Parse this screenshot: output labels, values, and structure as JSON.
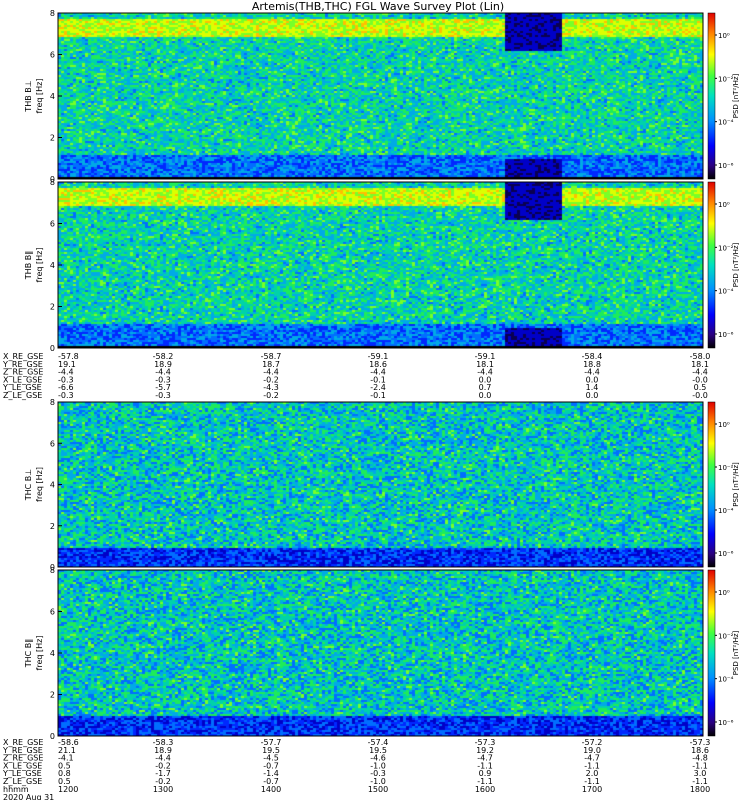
{
  "title": "Artemis(THB,THC) FGL Wave Survey Plot (Lin)",
  "colorbar": {
    "label": "PSD [nT²/Hz]",
    "ticks": [
      "10⁰",
      "10⁻²",
      "10⁻⁴",
      "10⁻⁶"
    ]
  },
  "chart_data": [
    {
      "type": "heatmap",
      "probe_label": "THB B⊥",
      "ylabel": "freq [Hz]",
      "ylim": [
        0,
        8
      ],
      "yticks": [
        0,
        2,
        4,
        6,
        8
      ],
      "colorscale": "log",
      "features": "strong power band 7-7.8 Hz, data gap near 1600",
      "colorbar_ticks": [
        "10⁰",
        "10⁻²",
        "10⁻⁴",
        "10⁻⁶"
      ]
    },
    {
      "type": "heatmap",
      "probe_label": "THB B‖",
      "ylabel": "freq [Hz]",
      "ylim": [
        0,
        8
      ],
      "yticks": [
        0,
        2,
        4,
        6,
        8
      ],
      "colorscale": "log",
      "features": "strong power band 7-7.8 Hz, data gap near 1600",
      "colorbar_ticks": [
        "10⁰",
        "10⁻²",
        "10⁻⁴",
        "10⁻⁶"
      ]
    },
    {
      "type": "heatmap",
      "probe_label": "THC B⊥",
      "ylabel": "freq [Hz]",
      "ylim": [
        0,
        8
      ],
      "yticks": [
        0,
        2,
        4,
        6,
        8
      ],
      "colorscale": "log",
      "colorbar_ticks": [
        "10⁰",
        "10⁻²",
        "10⁻⁴",
        "10⁻⁶"
      ]
    },
    {
      "type": "heatmap",
      "probe_label": "THC B‖",
      "ylabel": "freq [Hz]",
      "ylim": [
        0,
        8
      ],
      "yticks": [
        0,
        2,
        4,
        6,
        8
      ],
      "colorscale": "log",
      "colorbar_ticks": [
        "10⁰",
        "10⁻²",
        "10⁻⁴",
        "10⁻⁶"
      ]
    }
  ],
  "ephemeris_thb": {
    "rows": [
      {
        "label": "X_RE_GSE",
        "values": [
          "-57.8",
          "-58.2",
          "-58.7",
          "-59.1",
          "-59.1",
          "-58.4",
          "-58.0"
        ]
      },
      {
        "label": "Y_RE_GSE",
        "values": [
          "19.1",
          "18.9",
          "18.7",
          "18.6",
          "18.1",
          "18.8",
          "18.1"
        ]
      },
      {
        "label": "Z_RE_GSE",
        "values": [
          "-4.4",
          "-4.4",
          "-4.4",
          "-4.4",
          "-4.4",
          "-4.4",
          "-4.4"
        ]
      },
      {
        "label": "X_LE_GSE",
        "values": [
          "-0.3",
          "-0.3",
          "-0.2",
          "-0.1",
          "0.0",
          "0.0",
          "-0.0"
        ]
      },
      {
        "label": "Y_LE_GSE",
        "values": [
          "-6.6",
          "-5.7",
          "-4.3",
          "-2.4",
          "0.7",
          "1.4",
          "0.5"
        ]
      },
      {
        "label": "Z_LE_GSE",
        "values": [
          "-0.3",
          "-0.3",
          "-0.2",
          "-0.1",
          "0.0",
          "0.0",
          "-0.0"
        ]
      }
    ]
  },
  "ephemeris_thc": {
    "rows": [
      {
        "label": "X_RE_GSE",
        "values": [
          "-58.6",
          "-58.3",
          "-57.7",
          "-57.4",
          "-57.3",
          "-57.2",
          "-57.3"
        ]
      },
      {
        "label": "Y_RE_GSE",
        "values": [
          "21.1",
          "18.9",
          "19.5",
          "19.5",
          "19.2",
          "19.0",
          "18.6"
        ]
      },
      {
        "label": "Z_RE_GSE",
        "values": [
          "-4.1",
          "-4.4",
          "-4.5",
          "-4.6",
          "-4.7",
          "-4.7",
          "-4.8"
        ]
      },
      {
        "label": "X_LE_GSE",
        "values": [
          "0.5",
          "-0.2",
          "-0.7",
          "-1.0",
          "-1.1",
          "-1.1",
          "-1.1"
        ]
      },
      {
        "label": "Y_LE_GSE",
        "values": [
          "0.8",
          "-1.7",
          "-1.4",
          "-0.3",
          "0.9",
          "2.0",
          "3.0"
        ]
      },
      {
        "label": "Z_LE_GSE",
        "values": [
          "0.5",
          "-0.2",
          "-0.7",
          "-1.0",
          "-1.1",
          "-1.1",
          "-1.1"
        ]
      }
    ],
    "time_label": "hhmm",
    "times": [
      "1200",
      "1300",
      "1400",
      "1500",
      "1600",
      "1700",
      "1800"
    ],
    "date": "2020 Aug 31"
  }
}
